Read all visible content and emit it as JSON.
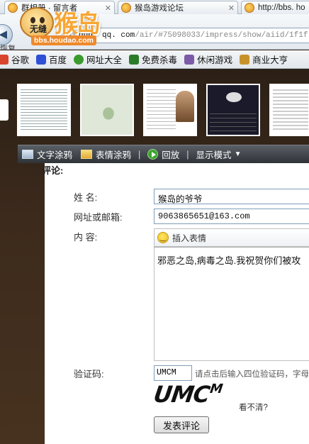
{
  "tabs": [
    {
      "label": "群相册 · 留言者"
    },
    {
      "label": "猴岛游戏论坛"
    },
    {
      "label": "http://bbs. ho"
    }
  ],
  "navigation": {
    "refresh_label": "恢复",
    "url_host": "qun. qq. com",
    "url_path": "/air/#75098033/impress/show/aiid/1f1f"
  },
  "logo": {
    "brand": "猴岛",
    "sub": "无缝",
    "domain": "bbs.houdao.com"
  },
  "bookmarks": [
    {
      "label": "谷歌",
      "icon": "google-icon",
      "color": "#d9442c"
    },
    {
      "label": "百度",
      "icon": "baidu-paw-icon",
      "color": "#2f4fd6"
    },
    {
      "label": "网址大全",
      "icon": "arrow-circle-icon",
      "color": "#3a9a2e"
    },
    {
      "label": "免费杀毒",
      "icon": "shield-icon",
      "color": "#2b7c29"
    },
    {
      "label": "休闲游戏",
      "icon": "gamepad-icon",
      "color": "#7d5aa8"
    },
    {
      "label": "商业大亨",
      "icon": "crown-icon",
      "color": "#c8922a"
    }
  ],
  "toolbar": {
    "text_graffiti": "文字涂鸦",
    "emoji_graffiti": "表情涂鸦",
    "replay": "回放",
    "display_mode": "显示模式",
    "separator": "|",
    "caret": "▼"
  },
  "form": {
    "title": "评论:",
    "name_label": "姓   名:",
    "name_value": "猴岛的爷爷",
    "email_label": "网址或邮箱:",
    "email_value": "9063865651@163.com",
    "content_label": "内   容:",
    "insert_emoji": "插入表情",
    "content_value": "邪恶之岛,病毒之岛.我祝贺你们被攻",
    "captcha_label": "验证码:",
    "captcha_value": "UMCM",
    "captcha_hint": "请点击后输入四位验证码，字母",
    "captcha_image_text": "UMC",
    "captcha_image_tail": "M",
    "refresh_link": "看不清?",
    "submit": "发表评论"
  }
}
